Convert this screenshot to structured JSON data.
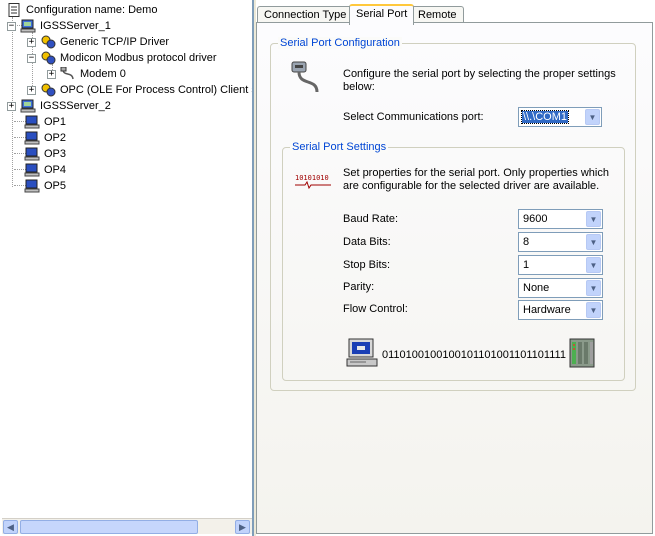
{
  "tree": {
    "root": "Configuration name: Demo",
    "server1": "IGSSServer_1",
    "driver_tcp": "Generic TCP/IP Driver",
    "driver_modbus": "Modicon Modbus protocol driver",
    "modem": "Modem 0",
    "driver_opc": "OPC (OLE For Process Control) Client si",
    "server2": "IGSSServer_2",
    "ops": [
      "OP1",
      "OP2",
      "OP3",
      "OP4",
      "OP5"
    ],
    "expand_plus": "+",
    "expand_minus": "−"
  },
  "scrollbar": {
    "left_arrow": "◀",
    "right_arrow": "▶"
  },
  "tabs": {
    "connection_type": "Connection Type",
    "serial_port": "Serial Port",
    "remote": "Remote"
  },
  "serial_config": {
    "title": "Serial Port Configuration",
    "description": "Configure the serial port by selecting the proper settings below:",
    "port_label": "Select Communications port:",
    "port_value": "\\\\.\\COM1"
  },
  "serial_settings": {
    "title": "Serial Port Settings",
    "description": "Set properties for the serial port. Only properties which are configurable for the selected driver are available.",
    "baud_label": "Baud Rate:",
    "baud_value": "9600",
    "databits_label": "Data Bits:",
    "databits_value": "8",
    "stopbits_label": "Stop Bits:",
    "stopbits_value": "1",
    "parity_label": "Parity:",
    "parity_value": "None",
    "flow_label": "Flow Control:",
    "flow_value": "Hardware",
    "wave_glyph": "10101010",
    "binary_text": "0110100100100101101001101101111"
  },
  "combo_arrow": "▼",
  "colors": {
    "group_title": "#0046d5",
    "tab_highlight": "#ffc83c",
    "selection": "#316ac5"
  }
}
